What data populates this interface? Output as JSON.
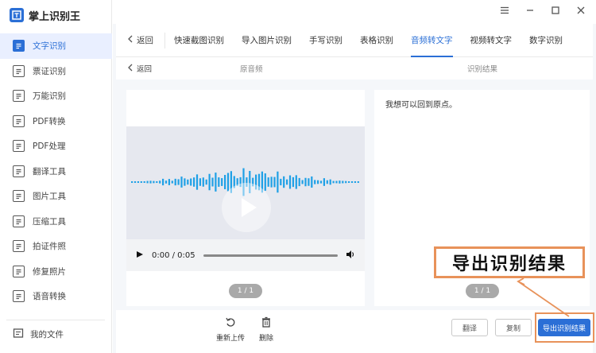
{
  "app": {
    "title": "掌上识别王"
  },
  "sidebar": {
    "items": [
      {
        "label": "文字识别",
        "icon": "text-recognition-icon",
        "active": true
      },
      {
        "label": "票证识别",
        "icon": "ticket-icon",
        "active": false
      },
      {
        "label": "万能识别",
        "icon": "universal-scan-icon",
        "active": false
      },
      {
        "label": "PDF转换",
        "icon": "pdf-convert-icon",
        "active": false
      },
      {
        "label": "PDF处理",
        "icon": "pdf-process-icon",
        "active": false
      },
      {
        "label": "翻译工具",
        "icon": "translate-icon",
        "active": false
      },
      {
        "label": "图片工具",
        "icon": "image-tool-icon",
        "active": false
      },
      {
        "label": "压缩工具",
        "icon": "compress-icon",
        "active": false
      },
      {
        "label": "拍证件照",
        "icon": "id-photo-icon",
        "active": false
      },
      {
        "label": "修复照片",
        "icon": "photo-repair-icon",
        "active": false
      },
      {
        "label": "语音转换",
        "icon": "voice-convert-icon",
        "active": false
      }
    ],
    "my_files": "我的文件"
  },
  "tabs": {
    "back": "返回",
    "items": [
      "快速截图识别",
      "导入图片识别",
      "手写识别",
      "表格识别",
      "音频转文字",
      "视频转文字",
      "数字识别"
    ],
    "active_index": 4
  },
  "subbar": {
    "back": "返回",
    "left_title": "原音频",
    "right_title": "识别结果"
  },
  "result": {
    "text": "我想可以回到原点。"
  },
  "player": {
    "time": "0:00 / 0:05",
    "progress": 0.0
  },
  "pager": {
    "left": "1 / 1",
    "right": "1 / 1"
  },
  "tools": {
    "reupload": "重新上传",
    "delete": "删除"
  },
  "buttons": {
    "translate": "翻译",
    "copy": "复制",
    "export": "导出识别结果"
  },
  "callout": {
    "text": "导出识别结果"
  },
  "colors": {
    "accent": "#2b6fd6",
    "wave": "#1ea0e6",
    "highlight": "#e8925a"
  }
}
